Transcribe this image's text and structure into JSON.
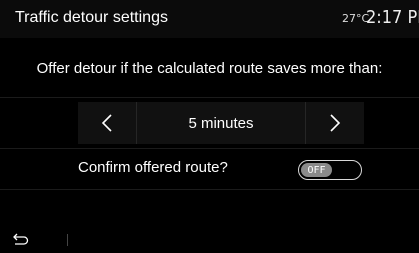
{
  "header": {
    "title": "Traffic detour settings",
    "temperature": "27°C",
    "time": "2:17 PM"
  },
  "main": {
    "question": "Offer detour if the calculated route saves more than:",
    "selector": {
      "value": "5 minutes",
      "prev_icon": "chevron-left-icon",
      "next_icon": "chevron-right-icon"
    },
    "confirm": {
      "label": "Confirm offered route?",
      "toggle_state": "OFF"
    }
  },
  "footer": {
    "back_icon": "back-arrow-icon"
  },
  "colors": {
    "background": "#000000",
    "header_bg": "#0b0b0b",
    "selector_bg": "#111111",
    "text": "#ffffff",
    "toggle_knob": "#8a8a8a"
  }
}
